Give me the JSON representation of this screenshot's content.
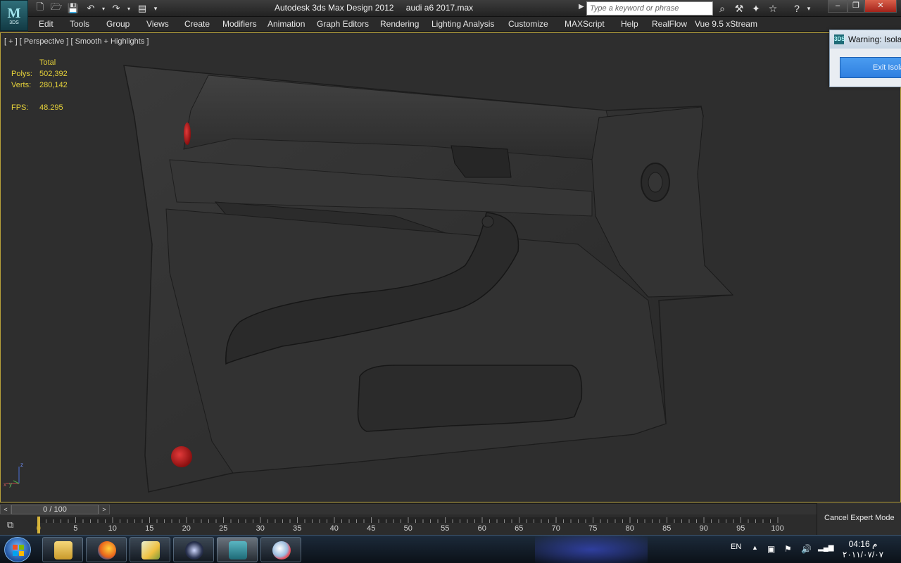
{
  "titlebar": {
    "app_logo_letter": "M",
    "app_logo_caption": "3DS",
    "app_name": "Autodesk 3ds Max Design 2012",
    "file_name": "audi a6 2017.max",
    "search_placeholder": "Type a keyword or phrase"
  },
  "menu": [
    "Edit",
    "Tools",
    "Group",
    "Views",
    "Create",
    "Modifiers",
    "Animation",
    "Graph Editors",
    "Rendering",
    "Lighting Analysis",
    "Customize",
    "MAXScript",
    "Help",
    "RealFlow",
    "Vue 9.5 xStream"
  ],
  "viewport": {
    "label": "[ + ] [ Perspective ] [ Smooth + Highlights ]",
    "stats": {
      "total_label": "Total",
      "polys_label": "Polys:",
      "polys_value": "502,392",
      "verts_label": "Verts:",
      "verts_value": "280,142",
      "fps_label": "FPS:",
      "fps_value": "48.295"
    },
    "axis": {
      "z": "z",
      "x": "x",
      "y": "y"
    }
  },
  "warning_dialog": {
    "icon_text": "3DS",
    "title": "Warning: Isola",
    "button_label": "Exit Isola"
  },
  "time_slider": {
    "prev": "<",
    "next": ">",
    "position": "0 / 100"
  },
  "trackbar": {
    "tick_labels": [
      "0",
      "5",
      "10",
      "15",
      "20",
      "25",
      "30",
      "35",
      "40",
      "45",
      "50",
      "55",
      "60",
      "65",
      "70",
      "75",
      "80",
      "85",
      "90",
      "95",
      "100"
    ]
  },
  "expert_mode": {
    "label": "Cancel Expert Mode"
  },
  "taskbar": {
    "language": "EN",
    "clock_time": "04:16 م",
    "clock_date": "٢٠١١/٠٧/٠٧",
    "apps": [
      "file-explorer",
      "firefox",
      "folder",
      "zoin",
      "3ds-max",
      "paint"
    ]
  },
  "colors": {
    "stats_yellow": "#e6d23a",
    "viewport_border": "#b8a23a",
    "dialog_button": "#2f7fe0"
  }
}
